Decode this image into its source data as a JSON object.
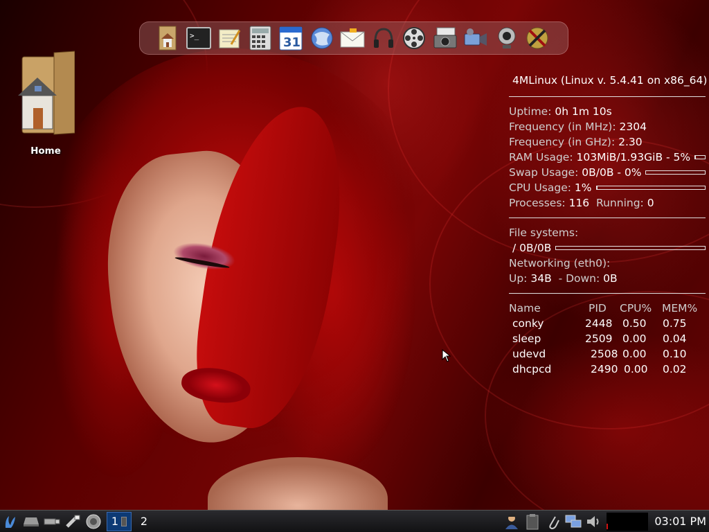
{
  "desktop": {
    "home_icon_label": "Home"
  },
  "dock": {
    "items": [
      {
        "icon": "home-folder-icon"
      },
      {
        "icon": "terminal-icon"
      },
      {
        "icon": "text-editor-icon"
      },
      {
        "icon": "calculator-icon"
      },
      {
        "icon": "calendar-icon",
        "text": "31"
      },
      {
        "icon": "web-browser-icon"
      },
      {
        "icon": "email-icon"
      },
      {
        "icon": "headphones-icon"
      },
      {
        "icon": "film-reel-icon"
      },
      {
        "icon": "screenshot-icon"
      },
      {
        "icon": "video-camera-icon"
      },
      {
        "icon": "webcam-icon"
      },
      {
        "icon": "xfce-settings-icon"
      }
    ]
  },
  "conky": {
    "title": "4MLinux (Linux v. 5.4.41 on x86_64)",
    "uptime_label": "Uptime:",
    "uptime_value": "0h 1m 10s",
    "freq_mhz_label": "Frequency (in MHz):",
    "freq_mhz_value": "2304",
    "freq_ghz_label": "Frequency (in GHz):",
    "freq_ghz_value": "2.30",
    "ram_label": "RAM Usage:",
    "ram_value": "103MiB/1.93GiB - 5%",
    "ram_fraction": 0.05,
    "swap_label": "Swap Usage:",
    "swap_value": "0B/0B - 0%",
    "swap_fraction": 0.0,
    "cpu_label": "CPU Usage:",
    "cpu_value": "1%",
    "cpu_fraction": 0.01,
    "processes_label": "Processes:",
    "processes_value": "116",
    "running_label": "Running:",
    "running_value": "0",
    "fs_label": "File systems:",
    "fs_root": "/",
    "fs_value": "0B/0B",
    "fs_fraction": 0.0,
    "net_label": "Networking (eth0):",
    "up_label": "Up:",
    "up_value": "34B",
    "down_label": "- Down:",
    "down_value": "0B",
    "proc_headers": [
      "Name",
      "PID",
      "CPU%",
      "MEM%"
    ],
    "processes": [
      {
        "name": "conky",
        "pid": "2448",
        "cpu": "0.50",
        "mem": "0.75"
      },
      {
        "name": "sleep",
        "pid": "2509",
        "cpu": "0.00",
        "mem": "0.04"
      },
      {
        "name": "udevd",
        "pid": "2508",
        "cpu": "0.00",
        "mem": "0.10"
      },
      {
        "name": "dhcpcd",
        "pid": "2490",
        "cpu": "0.00",
        "mem": "0.02"
      }
    ]
  },
  "taskbar": {
    "desktop_1": "1",
    "desktop_2": "2",
    "clock": "03:01 PM"
  }
}
